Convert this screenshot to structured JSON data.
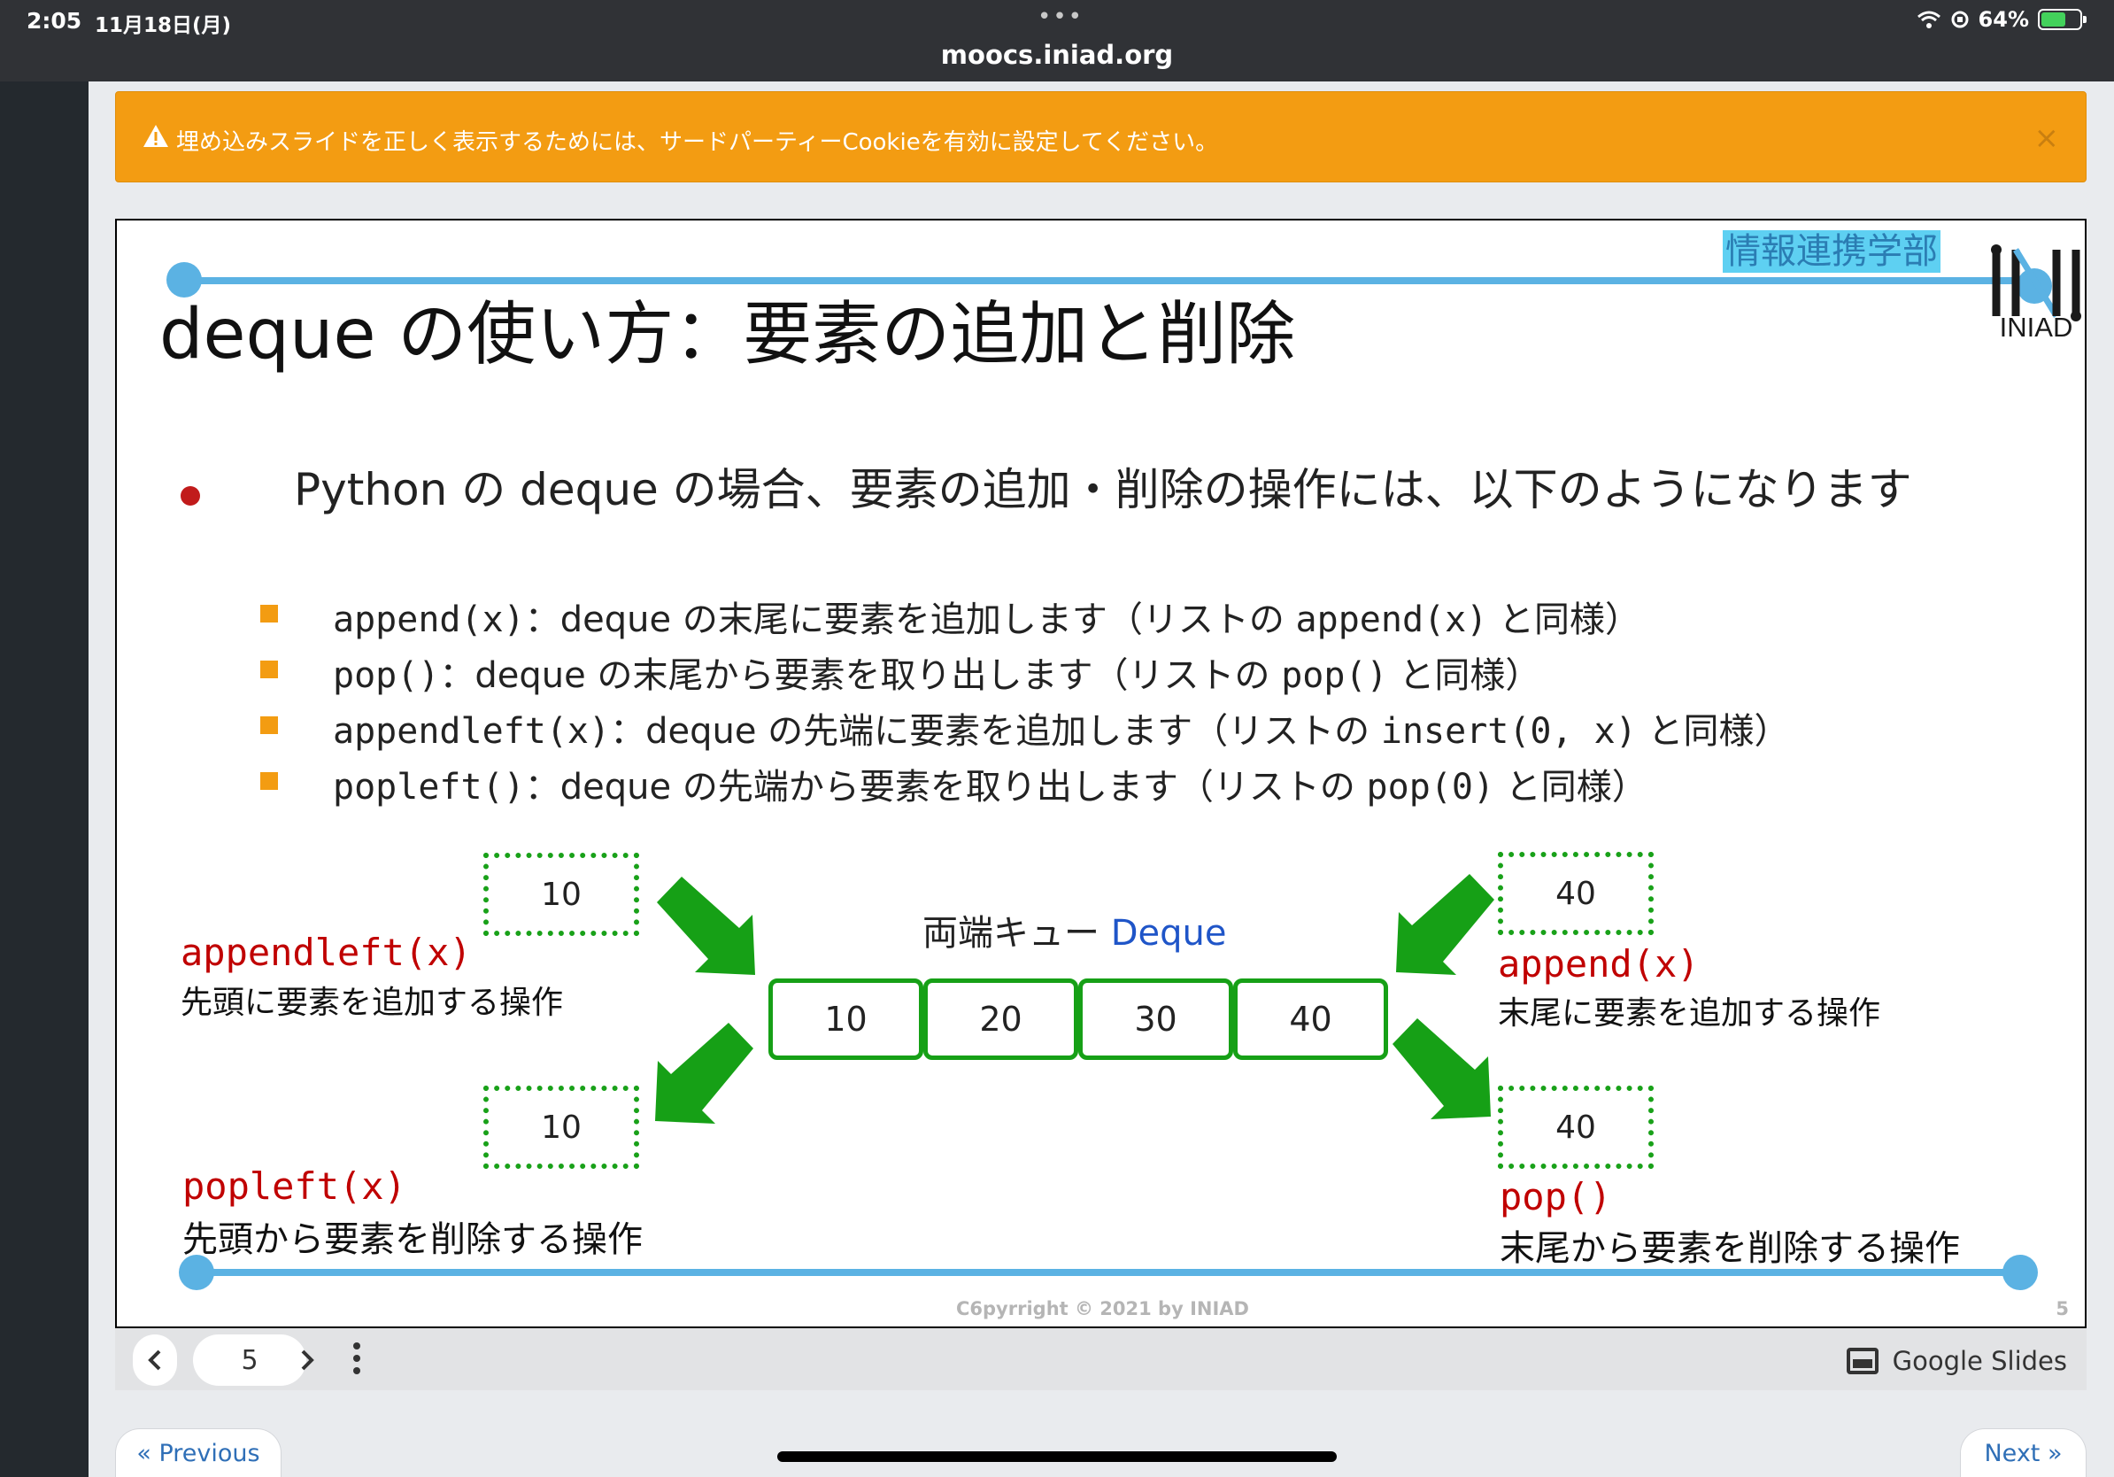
{
  "status_bar": {
    "time": "2:05",
    "date": "11月18日(月)",
    "url": "moocs.iniad.org",
    "battery": "64%",
    "battery_level": 0.64,
    "dots": "•••"
  },
  "alert": {
    "text": "埋め込みスライドを正しく表示するためには、サードパーティーCookieを有効に設定してください。",
    "close": "×"
  },
  "slide": {
    "faculty": "情報連携学部",
    "logo_text": "INIAD",
    "title": "deque の使い方：要素の追加と削除",
    "bullet": "Python の deque の場合、要素の追加・削除の操作には、以下のようになります",
    "subitems": [
      {
        "code": "append(x)",
        "text1": "：deque の末尾に要素を追加します（リストの ",
        "code2": "append(x)",
        "text2": " と同様）"
      },
      {
        "code": "pop()",
        "text1": "：deque の末尾から要素を取り出します（リストの ",
        "code2": "pop()",
        "text2": " と同様）"
      },
      {
        "code": "appendleft(x)",
        "text1": "：deque の先端に要素を追加します（リストの ",
        "code2": "insert(0, x)",
        "text2": " と同様）"
      },
      {
        "code": "popleft()",
        "text1": "：deque の先端から要素を取り出します（リストの ",
        "code2": "pop(0)",
        "text2": " と同様）"
      }
    ],
    "diagram": {
      "label_ja": "両端キュー",
      "label_en": "Deque",
      "cells": [
        "10",
        "20",
        "30",
        "40"
      ],
      "appendleft_value": "10",
      "popleft_value": "10",
      "append_value": "40",
      "pop_value": "40",
      "appendleft_name": "appendleft(x)",
      "appendleft_desc": "先頭に要素を追加する操作",
      "popleft_name": "popleft(x)",
      "popleft_desc": "先頭から要素を削除する操作",
      "append_name": "append(x)",
      "append_desc": "末尾に要素を追加する操作",
      "pop_name": "pop()",
      "pop_desc": "末尾から要素を削除する操作"
    },
    "copyright": "C6pyrright © 2021 by INIAD",
    "page_number": "5"
  },
  "controls": {
    "prev": "‹",
    "page": "5",
    "next": "›",
    "more": "⋮",
    "brand": "Google Slides"
  },
  "nav": {
    "previous": "« Previous",
    "next": "Next »"
  },
  "colors": {
    "alert": "#f39c12",
    "accent_blue": "#5bb2e3",
    "diagram_green": "#16a016",
    "code_red": "#c00000"
  }
}
